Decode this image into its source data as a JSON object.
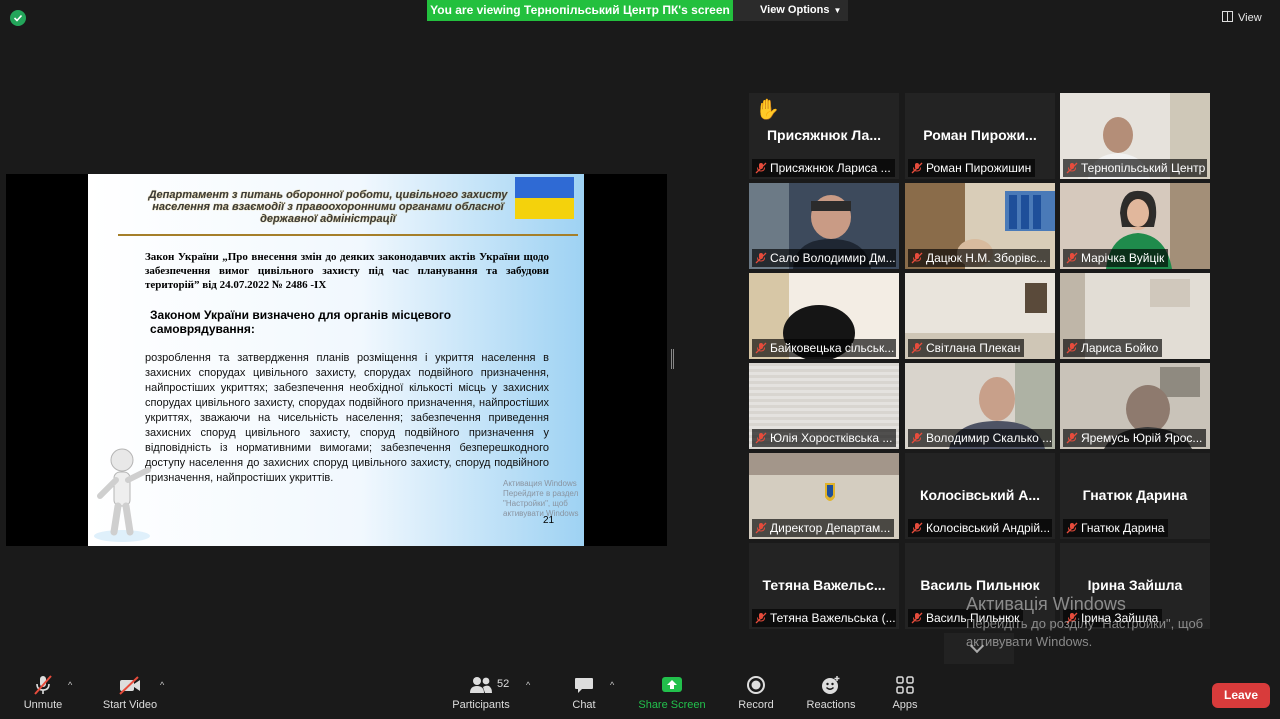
{
  "header": {
    "banner": "You are viewing Тернопільський Центр ПК's screen",
    "view_options": "View Options",
    "view": "View"
  },
  "slide": {
    "header": "Департамент з питань оборонної роботи, цивільного захисту населення та взаємодії з правоохоронними органами обласної державної адміністрації",
    "law": "Закон України „Про внесення змін до деяких законодавчих актів України щодо забезпечення вимог цивільного захисту під час планування та забудови територій” від 24.07.2022 № 2486 -ІХ",
    "subhead": "Законом України визначено для органів місцевого самоврядування:",
    "body": "розроблення та затвердження планів розміщення і укриття населення в захисних спорудах цивільного захисту, спорудах подвійного призначення, найпростіших укриттях; забезпечення необхідної кількості місць у захисних спорудах цивільного захисту, спорудах подвійного призначення, найпростіших укриттях, зважаючи на чисельність населення; забезпечення приведення захисних споруд цивільного захисту, споруд подвійного призначення у відповідність із нормативними вимогами; забезпечення безперешкодного доступу населення до захисних споруд цивільного захисту, споруд подвійного призначення, найпростіших укриттів.",
    "page_number": "21",
    "watermark": "Активация Windows\nПерейдите в раздел \"Настройки\", щоб\nактивувати Windows"
  },
  "participants": [
    {
      "big": "Присяжнюк  Ла...",
      "tag": "Присяжнюк Лариса ...",
      "hand": true
    },
    {
      "big": "Роман  Пирожи...",
      "tag": "Роман Пирожишин"
    },
    {
      "big": "",
      "tag": "Тернопільський Центр ...",
      "active": true
    },
    {
      "big": "",
      "tag": "Сало Володимир Дм..."
    },
    {
      "big": "",
      "tag": "Дацюк Н.М. Зборівс..."
    },
    {
      "big": "",
      "tag": "Марічка Вуйцік"
    },
    {
      "big": "",
      "tag": "Байковецька сільськ..."
    },
    {
      "big": "",
      "tag": "Світлана Плекан"
    },
    {
      "big": "",
      "tag": "Лариса Бойко"
    },
    {
      "big": "",
      "tag": "Юлія Хоростківська ..."
    },
    {
      "big": "",
      "tag": "Володимир Скалько ..."
    },
    {
      "big": "",
      "tag": "Яремусь Юрій Ярос..."
    },
    {
      "big": "",
      "tag": "Директор Департам..."
    },
    {
      "big": "Колосівський  А...",
      "tag": "Колосівський Андрій..."
    },
    {
      "big": "Гнатюк Дарина",
      "tag": "Гнатюк Дарина"
    },
    {
      "big": "Тетяна  Важельс...",
      "tag": "Тетяна Важельська (..."
    },
    {
      "big": "Василь  Пильнюк",
      "tag": "Василь Пильнюк"
    },
    {
      "big": "Ірина  Зайшла",
      "tag": "Ірина Зайшла"
    }
  ],
  "activation": {
    "title": "Активація Windows",
    "sub": "Перейдіть до розділу \"Настройки\", щоб активувати Windows."
  },
  "toolbar": {
    "unmute": "Unmute",
    "start_video": "Start Video",
    "participants": "Participants",
    "participant_count": "52",
    "chat": "Chat",
    "share_screen": "Share Screen",
    "record": "Record",
    "reactions": "Reactions",
    "apps": "Apps",
    "leave": "Leave"
  },
  "colors": {
    "banner": "#23c03e",
    "leave": "#d83b3b",
    "active_speaker": "#d5e052",
    "muted_mic": "#e74c3c"
  }
}
